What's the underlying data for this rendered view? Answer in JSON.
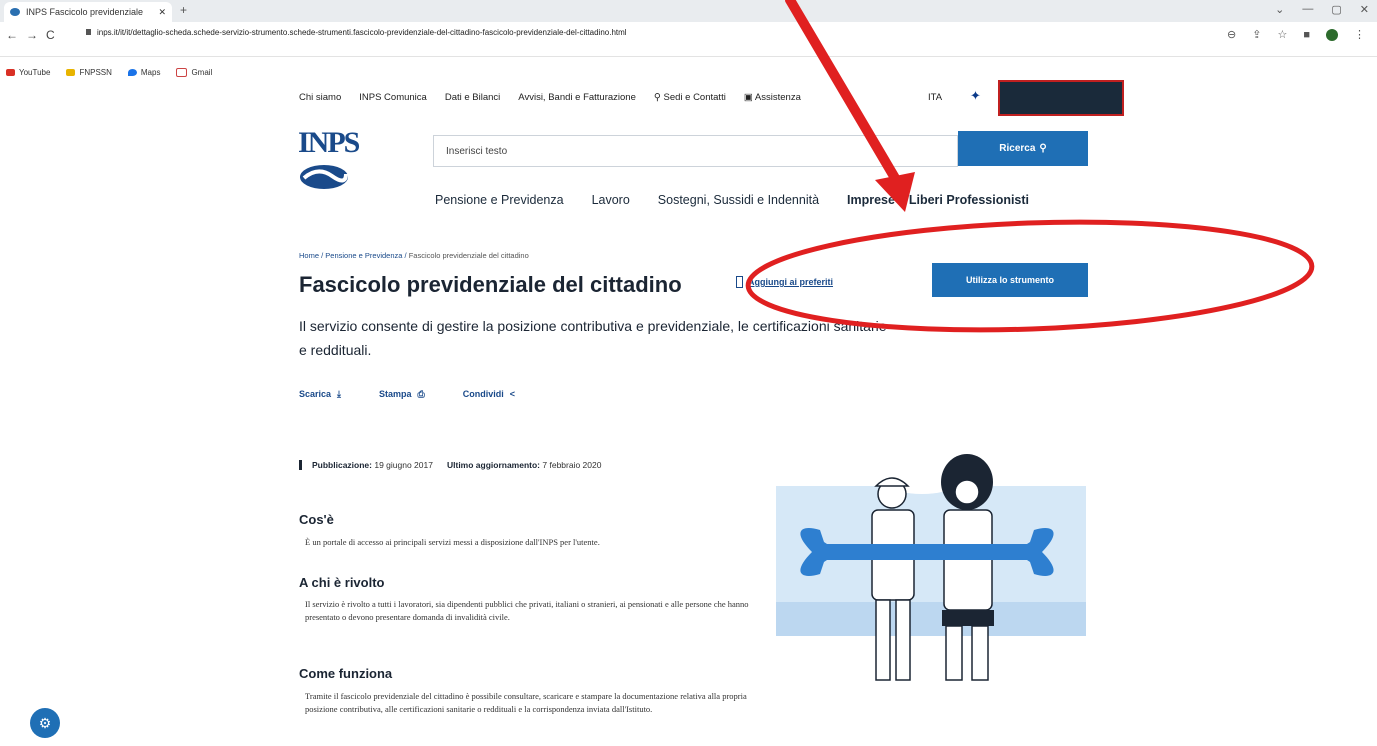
{
  "browser": {
    "tab_title": "INPS Fascicolo previdenziale",
    "new_tab": "+",
    "tab_close": "✕",
    "url": "inps.it/it/it/dettaglio-scheda.schede-servizio-strumento.schede-strumenti.fascicolo-previdenziale-del-cittadino-fascicolo-previdenziale-del-cittadino.html",
    "nav_back": "←",
    "nav_forward": "→",
    "reload": "C",
    "bookmarks": [
      "YouTube",
      "FNPSSN",
      "Maps",
      "Gmail"
    ],
    "window_controls": [
      "⌄",
      "—",
      "▢",
      "✕"
    ]
  },
  "header": {
    "utility_links": [
      "Chi siamo",
      "INPS Comunica",
      "Dati e Bilanci",
      "Avvisi, Bandi e Fatturazione",
      "Sedi e Contatti",
      "Assistenza"
    ],
    "lang": "ITA",
    "logo_text": "INPS"
  },
  "search": {
    "placeholder": "Inserisci testo",
    "button_label": "Ricerca"
  },
  "main_nav": [
    "Pensione e Previdenza",
    "Lavoro",
    "Sostegni, Sussidi e Indennità",
    "Imprese e Liberi Professionisti"
  ],
  "breadcrumb": {
    "home": "Home",
    "parent": "Pensione e Previdenza",
    "current": "Fascicolo previdenziale del cittadino"
  },
  "page": {
    "title": "Fascicolo previdenziale del cittadino",
    "favorite_link": "Aggiungi ai preferiti",
    "primary_button": "Utilizza lo strumento",
    "description": "Il servizio consente di gestire la posizione contributiva e previdenziale, le certificazioni sanitarie e reddituali.",
    "actions": [
      {
        "label": "Scarica",
        "icon": "⤓"
      },
      {
        "label": "Stampa",
        "icon": "⎙"
      },
      {
        "label": "Condividi",
        "icon": "<"
      }
    ],
    "meta": {
      "published_label": "Pubblicazione:",
      "published_value": "19 giugno 2017",
      "updated_label": "Ultimo aggiornamento:",
      "updated_value": "7 febbraio 2020"
    },
    "sections": [
      {
        "heading": "Cos'è",
        "text": "È un portale di accesso ai principali servizi messi a disposizione dall'INPS per l'utente."
      },
      {
        "heading": "A chi è rivolto",
        "text": "Il servizio è rivolto a tutti i lavoratori, sia dipendenti pubblici che privati, italiani o stranieri, ai pensionati e alle persone che hanno presentato o devono presentare domanda di invalidità civile."
      },
      {
        "heading": "Come funziona",
        "text": "Tramite il fascicolo previdenziale del cittadino è possibile consultare, scaricare e stampare la documentazione relativa alla propria posizione contributiva, alle certificazioni sanitarie o reddituali e la corrispondenza inviata dall'Istituto."
      }
    ]
  },
  "colors": {
    "primary": "#1f6fb5",
    "annotation_red": "#e02020",
    "text_dark": "#1b2533"
  },
  "icons": [
    "search-icon",
    "bell-icon",
    "map-pin-icon",
    "gear-icon",
    "bookmark-icon",
    "download-icon",
    "print-icon",
    "share-icon"
  ]
}
